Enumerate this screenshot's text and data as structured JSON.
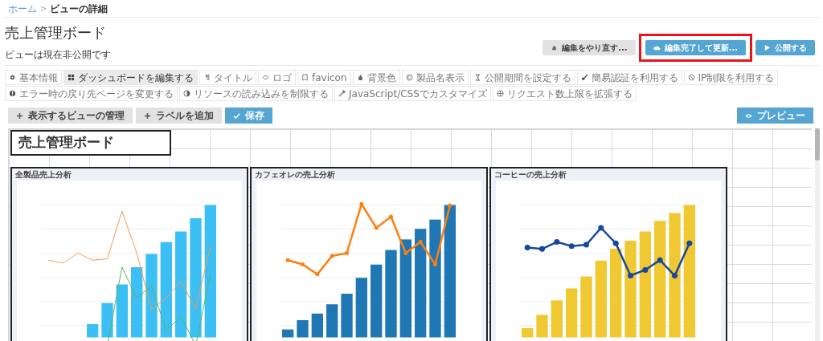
{
  "breadcrumb": {
    "separator": ">",
    "items": [
      {
        "label": "ホーム",
        "link": true
      },
      {
        "label": "ビューの詳細",
        "link": false
      }
    ]
  },
  "title": "売上管理ボード",
  "status": "ビューは現在非公開です",
  "header_buttons": [
    {
      "label": "編集をやり直す...",
      "kind": "secondary",
      "highlighted": false
    },
    {
      "label": "編集完了して更新...",
      "kind": "primary",
      "highlighted": true
    },
    {
      "label": "公開する",
      "kind": "primary",
      "highlighted": false
    }
  ],
  "tabs": [
    {
      "label": "基本情報",
      "selected": false
    },
    {
      "label": "ダッシュボードを編集する",
      "selected": true
    },
    {
      "label": "タイトル",
      "selected": false
    },
    {
      "label": "ロゴ",
      "selected": false
    },
    {
      "label": "favicon",
      "selected": false
    },
    {
      "label": "背景色",
      "selected": false
    },
    {
      "label": "製品名表示",
      "selected": false
    },
    {
      "label": "公開期間を設定する",
      "selected": false
    },
    {
      "label": "簡易認証を利用する",
      "selected": false
    },
    {
      "label": "IP制限を利用する",
      "selected": false
    },
    {
      "label": "エラー時の戻り先ページを変更する",
      "selected": false
    },
    {
      "label": "リソースの読み込みを制限する",
      "selected": false
    },
    {
      "label": "JavaScript/CSSでカスタマイズ",
      "selected": false
    },
    {
      "label": "リクエスト数上限を拡張する",
      "selected": false
    }
  ],
  "toolbar": [
    {
      "label": "表示するビューの管理",
      "kind": "secondary"
    },
    {
      "label": "ラベルを追加",
      "kind": "secondary"
    },
    {
      "label": "保存",
      "kind": "primary"
    }
  ],
  "preview_button": "プレビュー",
  "canvas": {
    "title_widget": "売上管理ボード",
    "panels": [
      {
        "title": "全製品売上分析"
      },
      {
        "title": "カフェオレの売上分析"
      },
      {
        "title": "コーヒーの売上分析"
      }
    ]
  }
}
